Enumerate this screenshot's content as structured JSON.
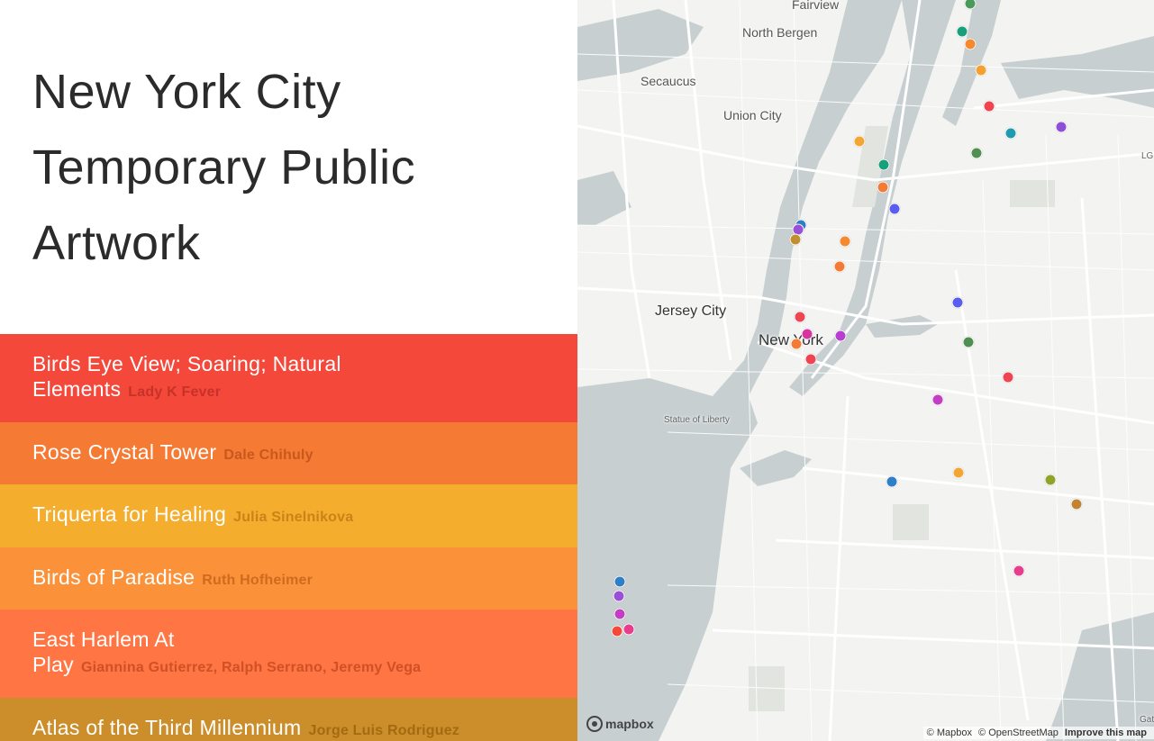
{
  "page": {
    "title_lines": [
      "New York City",
      "Temporary Public",
      "Artwork"
    ]
  },
  "artworks": [
    {
      "title_line1": "Birds Eye View; Soaring; Natural",
      "title_line2": "Elements",
      "artist": "Lady K Fever",
      "bg": "#f4483b",
      "artist_color": "#c73228"
    },
    {
      "title_line1": "Rose Crystal Tower",
      "title_line2": "",
      "artist": "Dale Chihuly",
      "bg": "#f57a33",
      "artist_color": "#c8581d"
    },
    {
      "title_line1": "Triquerta for Healing",
      "title_line2": "",
      "artist": "Julia Sinelnikova",
      "bg": "#f5ad2e",
      "artist_color": "#c98318"
    },
    {
      "title_line1": "Birds of Paradise",
      "title_line2": "",
      "artist": "Ruth Hofheimer",
      "bg": "#fb923a",
      "artist_color": "#cf6a1f"
    },
    {
      "title_line1": "East Harlem At",
      "title_line2": "Play",
      "artist": "Giannina Gutierrez, Ralph Serrano, Jeremy Vega",
      "bg": "#ff7543",
      "artist_color": "#cf5125"
    },
    {
      "title_line1": "Atlas of the Third Millennium",
      "title_line2": "",
      "artist": "Jorge Luis Rodriguez",
      "bg": "#cc8e2a",
      "artist_color": "#a36a12"
    }
  ],
  "map": {
    "place_labels": {
      "fairview": "Fairview",
      "north_bergen": "North Bergen",
      "secaucus": "Secaucus",
      "union_city": "Union City",
      "jersey_city": "Jersey City",
      "new_york": "New York",
      "statue": "Statue of Liberty",
      "lg": "LG",
      "gat": "Gat"
    },
    "markers": [
      {
        "color": "#4a9a5c"
      },
      {
        "color": "#17a07b"
      },
      {
        "color": "#f5892f"
      },
      {
        "color": "#f5a032"
      },
      {
        "color": "#ef4451"
      },
      {
        "color": "#1f9bb0"
      },
      {
        "color": "#8d4ed8"
      },
      {
        "color": "#4f8f52"
      },
      {
        "color": "#f2a735"
      },
      {
        "color": "#17a07b"
      },
      {
        "color": "#f57a33"
      },
      {
        "color": "#5a5df0"
      },
      {
        "color": "#2f7ec8"
      },
      {
        "color": "#9a4fd8"
      },
      {
        "color": "#c18f2f"
      },
      {
        "color": "#f5892f"
      },
      {
        "color": "#f57a33"
      },
      {
        "color": "#5a5df0"
      },
      {
        "color": "#ef4451"
      },
      {
        "color": "#d6349f"
      },
      {
        "color": "#b73fd0"
      },
      {
        "color": "#f57a33"
      },
      {
        "color": "#ef4451"
      },
      {
        "color": "#4f8f52"
      },
      {
        "color": "#ef4451"
      },
      {
        "color": "#c43ec4"
      },
      {
        "color": "#f2a735"
      },
      {
        "color": "#2f7ec8"
      },
      {
        "color": "#8fa52a"
      },
      {
        "color": "#c08432"
      },
      {
        "color": "#e83c8c"
      },
      {
        "color": "#2f7ec8"
      },
      {
        "color": "#9a4fd8"
      },
      {
        "color": "#c43ec4"
      },
      {
        "color": "#e83c8c"
      },
      {
        "color": "#f4483b"
      }
    ],
    "logo_text": "mapbox",
    "attribution": {
      "mapbox": "© Mapbox",
      "osm": "© OpenStreetMap",
      "improve": "Improve this map"
    }
  }
}
